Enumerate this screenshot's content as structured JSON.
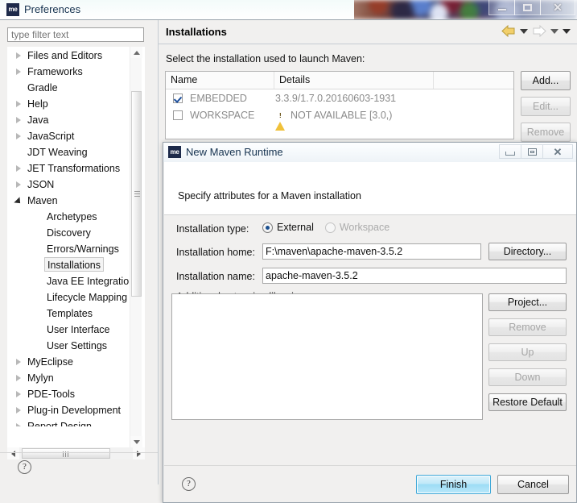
{
  "window": {
    "title": "Preferences",
    "icon_label": "me",
    "controls": {
      "minimize": "minimize-icon",
      "maximize": "maximize-icon",
      "close": "close-icon"
    }
  },
  "sidebar": {
    "filter_placeholder": "type filter text",
    "filter_value": "",
    "items": [
      {
        "label": "Files and Editors",
        "state": "collapsed",
        "level": 0
      },
      {
        "label": "Frameworks",
        "state": "collapsed",
        "level": 0
      },
      {
        "label": "Gradle",
        "state": "leaf",
        "level": 0
      },
      {
        "label": "Help",
        "state": "collapsed",
        "level": 0
      },
      {
        "label": "Java",
        "state": "collapsed",
        "level": 0
      },
      {
        "label": "JavaScript",
        "state": "collapsed",
        "level": 0
      },
      {
        "label": "JDT Weaving",
        "state": "leaf",
        "level": 0
      },
      {
        "label": "JET Transformations",
        "state": "collapsed",
        "level": 0
      },
      {
        "label": "JSON",
        "state": "collapsed",
        "level": 0
      },
      {
        "label": "Maven",
        "state": "expanded",
        "level": 0
      },
      {
        "label": "Archetypes",
        "state": "leaf",
        "level": 1
      },
      {
        "label": "Discovery",
        "state": "leaf",
        "level": 1
      },
      {
        "label": "Errors/Warnings",
        "state": "leaf",
        "level": 1
      },
      {
        "label": "Installations",
        "state": "leaf",
        "level": 1,
        "selected": true
      },
      {
        "label": "Java EE Integration",
        "state": "leaf",
        "level": 1
      },
      {
        "label": "Lifecycle Mapping",
        "state": "leaf",
        "level": 1
      },
      {
        "label": "Templates",
        "state": "leaf",
        "level": 1
      },
      {
        "label": "User Interface",
        "state": "leaf",
        "level": 1
      },
      {
        "label": "User Settings",
        "state": "leaf",
        "level": 1
      },
      {
        "label": "MyEclipse",
        "state": "collapsed",
        "level": 0
      },
      {
        "label": "Mylyn",
        "state": "collapsed",
        "level": 0
      },
      {
        "label": "PDE-Tools",
        "state": "collapsed",
        "level": 0
      },
      {
        "label": "Plug-in Development",
        "state": "collapsed",
        "level": 0
      },
      {
        "label": "Report Design",
        "state": "collapsed",
        "level": 0,
        "clipped": true
      }
    ]
  },
  "panel": {
    "title": "Installations",
    "description": "Select the installation used to launch Maven:",
    "nav": {
      "back": "back-arrow-icon",
      "back_menu": "chevron-down-icon",
      "forward": "forward-arrow-icon",
      "forward_menu": "chevron-down-icon",
      "view_menu": "chevron-down-icon"
    },
    "table": {
      "columns": [
        "Name",
        "Details",
        ""
      ],
      "rows": [
        {
          "checked": true,
          "name": "EMBEDDED",
          "details": "3.3.9/1.7.0.20160603-1931",
          "warning": false
        },
        {
          "checked": false,
          "name": "WORKSPACE",
          "details": "NOT AVAILABLE [3.0,)",
          "warning": true
        }
      ]
    },
    "buttons": [
      {
        "label": "Add...",
        "enabled": true
      },
      {
        "label": "Edit...",
        "enabled": false
      },
      {
        "label": "Remove",
        "enabled": false
      }
    ]
  },
  "dialog": {
    "title": "New Maven Runtime",
    "icon_label": "me",
    "banner_text": "Specify attributes for a Maven installation",
    "controls": {
      "minimize": "minimize-icon",
      "maximize": "maximize-icon",
      "close": "close-icon"
    },
    "fields": {
      "installation_type_label": "Installation type:",
      "radio_external": "External",
      "radio_workspace": "Workspace",
      "selected_type": "External",
      "installation_home_label": "Installation home:",
      "installation_home_value": "F:\\maven\\apache-maven-3.5.2",
      "directory_button": "Directory...",
      "installation_name_label": "Installation name:",
      "installation_name_value": "apache-maven-3.5.2",
      "libraries_label": "Additional extension libraries:",
      "libraries_items": []
    },
    "side_buttons": [
      {
        "label": "Project...",
        "enabled": true
      },
      {
        "label": "Remove",
        "enabled": false
      },
      {
        "label": "Up",
        "enabled": false
      },
      {
        "label": "Down",
        "enabled": false
      },
      {
        "label": "Restore Default",
        "enabled": true
      }
    ],
    "footer": {
      "help": "?",
      "finish": "Finish",
      "cancel": "Cancel"
    }
  },
  "preferences_footer": {
    "help": "?"
  },
  "colors": {
    "accent_blue": "#9ddcf5",
    "warning_yellow": "#f0c13a",
    "title_text": "#14314e",
    "panel_bg": "#f1f0ef"
  }
}
